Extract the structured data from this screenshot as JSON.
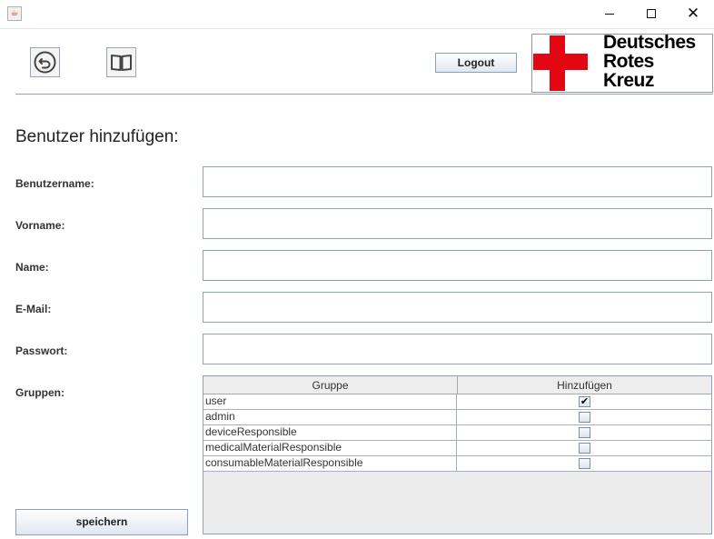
{
  "window": {
    "app_icon": "java-coffee-icon",
    "minimize_icon": "minimize-icon",
    "maximize_icon": "maximize-icon",
    "close_icon": "close-icon"
  },
  "toolbar": {
    "back_icon": "back-arrow-icon",
    "help_icon": "open-book-icon",
    "logout_label": "Logout"
  },
  "logo": {
    "line1": "Deutsches",
    "line2": "Rotes",
    "line3": "Kreuz",
    "cross_color": "#e30613"
  },
  "form": {
    "title": "Benutzer hinzufügen:",
    "username_label": "Benutzername:",
    "username_value": "",
    "firstname_label": "Vorname:",
    "firstname_value": "",
    "lastname_label": "Name:",
    "lastname_value": "",
    "email_label": "E-Mail:",
    "email_value": "",
    "password_label": "Passwort:",
    "password_value": "",
    "groups_label": "Gruppen:"
  },
  "groups_table": {
    "headers": [
      "Gruppe",
      "Hinzufügen"
    ],
    "rows": [
      {
        "name": "user",
        "checked": true
      },
      {
        "name": "admin",
        "checked": false
      },
      {
        "name": "deviceResponsible",
        "checked": false
      },
      {
        "name": "medicalMaterialResponsible",
        "checked": false
      },
      {
        "name": "consumableMaterialResponsible",
        "checked": false
      }
    ]
  },
  "actions": {
    "save_label": "speichern"
  }
}
